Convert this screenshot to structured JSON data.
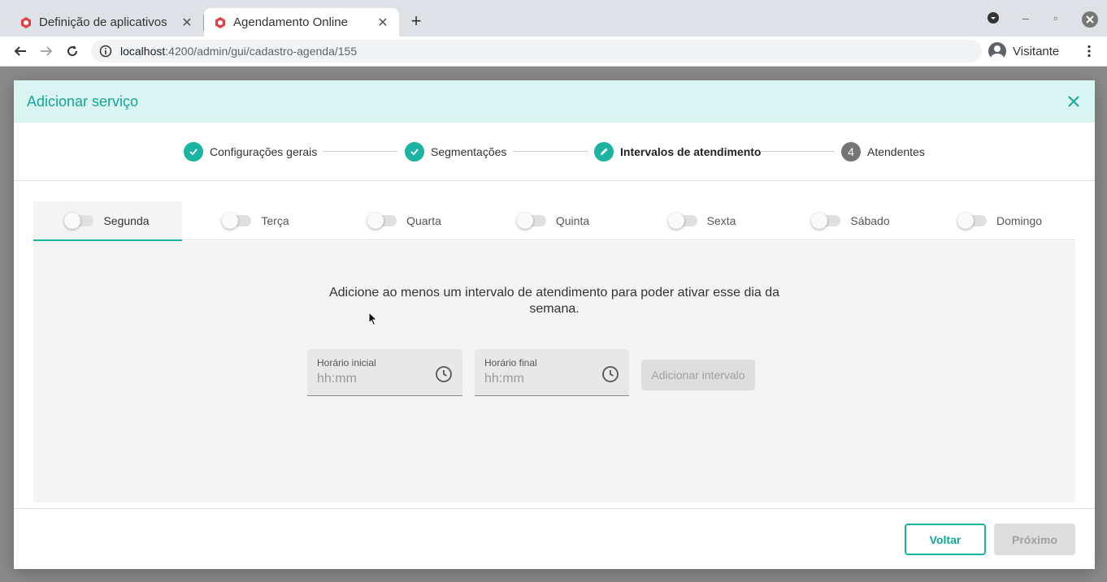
{
  "browser": {
    "tabs": [
      {
        "title": "Definição de aplicativos",
        "active": false
      },
      {
        "title": "Agendamento Online",
        "active": true
      }
    ],
    "url_host": "localhost",
    "url_path": ":4200/admin/gui/cadastro-agenda/155",
    "profile_name": "Visitante"
  },
  "dialog": {
    "title": "Adicionar serviço",
    "steps": [
      {
        "label": "Configurações gerais",
        "state": "done"
      },
      {
        "label": "Segmentações",
        "state": "done"
      },
      {
        "label": "Intervalos de atendimento",
        "state": "current"
      },
      {
        "label": "Atendentes",
        "state": "pending",
        "number": "4"
      }
    ],
    "day_tabs": [
      {
        "label": "Segunda",
        "active": true
      },
      {
        "label": "Terça",
        "active": false
      },
      {
        "label": "Quarta",
        "active": false
      },
      {
        "label": "Quinta",
        "active": false
      },
      {
        "label": "Sexta",
        "active": false
      },
      {
        "label": "Sábado",
        "active": false
      },
      {
        "label": "Domingo",
        "active": false
      }
    ],
    "message": "Adicione ao menos um intervalo de atendimento para poder ativar esse dia da semana.",
    "start_field": {
      "label": "Horário inicial",
      "placeholder": "hh:mm"
    },
    "end_field": {
      "label": "Horário final",
      "placeholder": "hh:mm"
    },
    "add_interval_label": "Adicionar intervalo",
    "back_label": "Voltar",
    "next_label": "Próximo"
  },
  "colors": {
    "accent": "#1bb3a2",
    "header_bg": "#d9f4f1",
    "disabled_bg": "#dedede"
  }
}
